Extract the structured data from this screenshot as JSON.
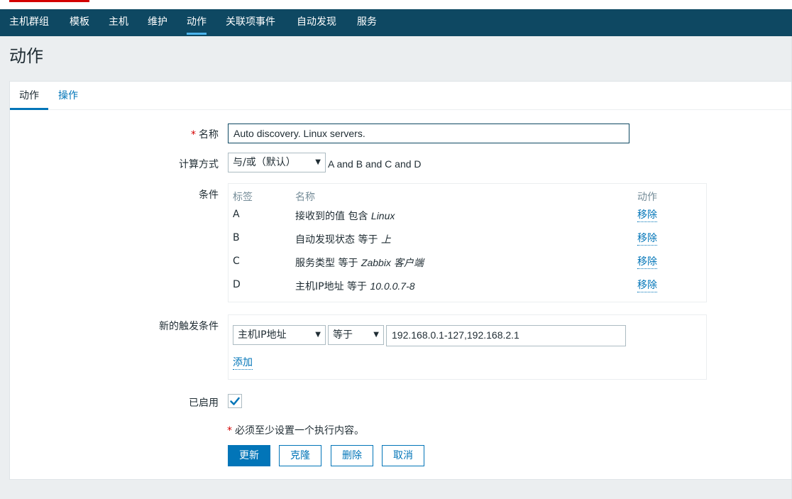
{
  "nav": {
    "items": [
      {
        "label": "主机群组"
      },
      {
        "label": "模板"
      },
      {
        "label": "主机"
      },
      {
        "label": "维护"
      },
      {
        "label": "动作",
        "active": true
      },
      {
        "label": "关联项事件"
      },
      {
        "label": "自动发现"
      },
      {
        "label": "服务"
      }
    ]
  },
  "page": {
    "title": "动作"
  },
  "tabs": [
    {
      "label": "动作",
      "active": true
    },
    {
      "label": "操作"
    }
  ],
  "form": {
    "required_mark": "*",
    "name_label": "名称",
    "name_value": "Auto discovery. Linux servers.",
    "calc_label": "计算方式",
    "calc_value": "与/或（默认）",
    "calc_formula": "A and B and C and D",
    "conditions_label": "条件",
    "conditions": {
      "headers": {
        "tag": "标签",
        "name": "名称",
        "action": "动作"
      },
      "rows": [
        {
          "tag": "A",
          "name": "接收到的值 包含 ",
          "value": "Linux",
          "action": "移除"
        },
        {
          "tag": "B",
          "name": "自动发现状态 等于 ",
          "value": "上",
          "action": "移除"
        },
        {
          "tag": "C",
          "name": "服务类型 等于 ",
          "value": "Zabbix 客户端",
          "action": "移除"
        },
        {
          "tag": "D",
          "name": "主机IP地址 等于 ",
          "value": "10.0.0.7-8",
          "action": "移除"
        }
      ]
    },
    "new_condition_label": "新的触发条件",
    "new_condition": {
      "type_value": "主机IP地址",
      "operator_value": "等于",
      "input_value": "192.168.0.1-127,192.168.2.1",
      "add_label": "添加"
    },
    "enabled_label": "已启用",
    "enabled": true,
    "note": "必须至少设置一个执行内容。",
    "buttons": {
      "update": "更新",
      "clone": "克隆",
      "delete": "删除",
      "cancel": "取消"
    }
  },
  "colors": {
    "nav_bg": "#0e4862",
    "accent": "#0275b8",
    "required": "#d40000",
    "page_bg": "#ebeef0"
  }
}
